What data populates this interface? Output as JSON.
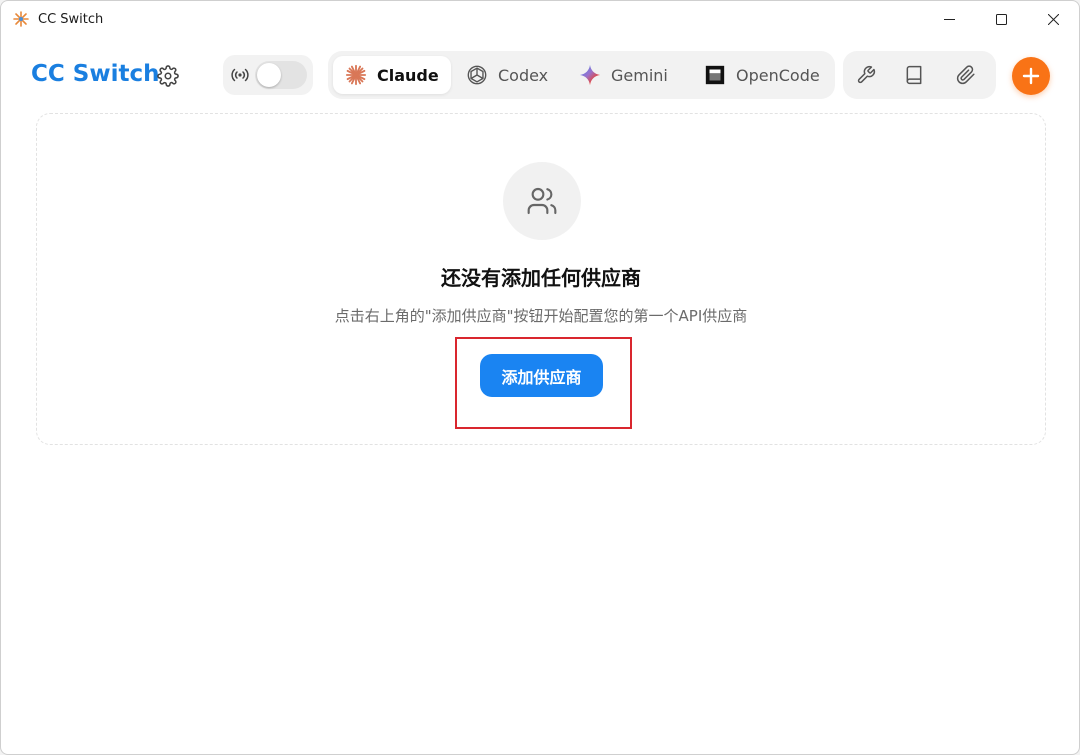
{
  "window": {
    "title": "CC Switch"
  },
  "header": {
    "brand": "CC Switch",
    "tabs": [
      {
        "label": "Claude",
        "icon": "claude-icon",
        "active": true
      },
      {
        "label": "Codex",
        "icon": "codex-icon",
        "active": false
      },
      {
        "label": "Gemini",
        "icon": "gemini-icon",
        "active": false
      },
      {
        "label": "OpenCode",
        "icon": "opencode-icon",
        "active": false
      }
    ],
    "tools": [
      "wrench-icon",
      "book-icon",
      "paperclip-icon"
    ]
  },
  "empty_state": {
    "title": "还没有添加任何供应商",
    "description": "点击右上角的\"添加供应商\"按钮开始配置您的第一个API供应商",
    "button_label": "添加供应商"
  },
  "colors": {
    "brand": "#1a7fe0",
    "primary": "#1a84f2",
    "accent": "#f97316",
    "highlight": "#d9262e"
  }
}
